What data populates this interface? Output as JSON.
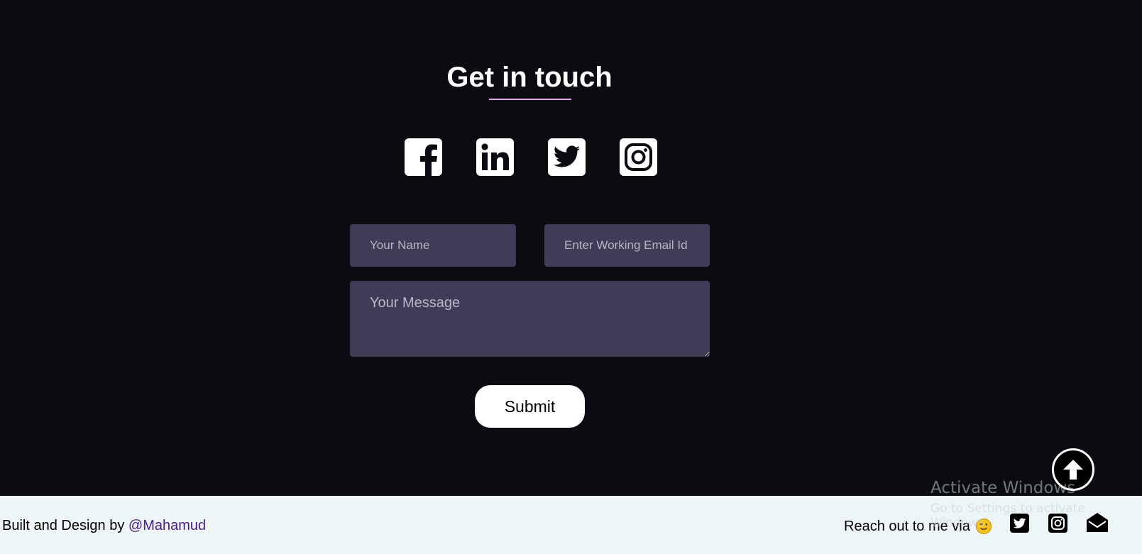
{
  "contact": {
    "title": "Get in touch",
    "accent_color": "#e7a6e9",
    "socials": [
      {
        "name": "facebook",
        "icon": "facebook-icon"
      },
      {
        "name": "linkedin",
        "icon": "linkedin-icon"
      },
      {
        "name": "twitter",
        "icon": "twitter-icon"
      },
      {
        "name": "instagram",
        "icon": "instagram-icon"
      }
    ],
    "form": {
      "name_placeholder": "Your Name",
      "name_value": "",
      "email_placeholder": "Enter Working Email Id",
      "email_value": "",
      "message_placeholder": "Your Message",
      "message_value": "",
      "submit_label": "Submit",
      "field_color": "#413c56"
    },
    "scroll_top_icon": "arrow-up-icon"
  },
  "footer": {
    "credit_prefix": "Built and Design by",
    "credit_link": "@Mahamud",
    "reach_text": "Reach out to me via",
    "reach_emoji": "winking-face-emoji",
    "icons": [
      "twitter-icon",
      "instagram-icon",
      "mail-icon"
    ],
    "background": "#eef5f7",
    "link_color": "#4b1c86"
  },
  "watermark": {
    "title": "Activate Windows",
    "subtitle": "Go to Settings to activate Windows."
  }
}
